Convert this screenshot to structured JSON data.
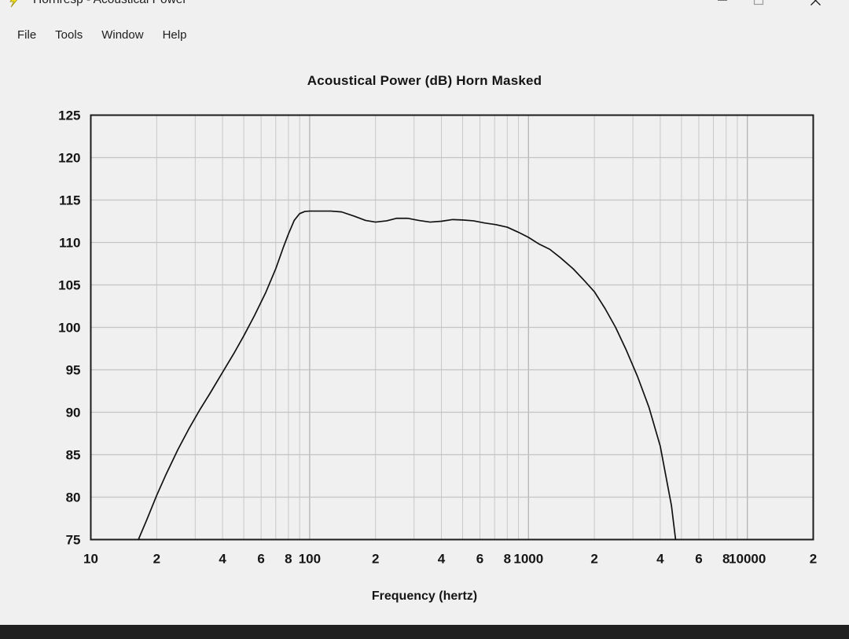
{
  "window": {
    "title": "Hornresp - Acoustical Power",
    "icon": "lightning-bolt-icon",
    "controls": {
      "minimize": "–",
      "maximize": "□",
      "close": "✕"
    }
  },
  "menubar": {
    "items": [
      {
        "label": "File"
      },
      {
        "label": "Tools"
      },
      {
        "label": "Window"
      },
      {
        "label": "Help"
      }
    ]
  },
  "chart_data": {
    "type": "line",
    "title": "Acoustical Power (dB)   Horn   Masked",
    "title_parts": [
      "Acoustical Power (dB)",
      "Horn",
      "Masked"
    ],
    "xlabel": "Frequency (hertz)",
    "ylabel": "",
    "xscale": "log",
    "xlim": [
      10,
      20000
    ],
    "ylim": [
      75,
      125
    ],
    "grid": true,
    "legend": "none",
    "line_color": "#111111",
    "grid_color": "#c8c8c8",
    "axis_color": "#1b1b1b",
    "plot_bg": "#ffffff",
    "ytick_labels": [
      "125",
      "120",
      "115",
      "110",
      "105",
      "100",
      "95",
      "90",
      "85",
      "80",
      "75"
    ],
    "ytick_values": [
      125,
      120,
      115,
      110,
      105,
      100,
      95,
      90,
      85,
      80,
      75
    ],
    "xtick_labels": [
      "10",
      "2",
      "4",
      "6",
      "8",
      "100",
      "2",
      "4",
      "6",
      "8",
      "1000",
      "2",
      "4",
      "6",
      "8",
      "10000",
      "2"
    ],
    "xtick_values": [
      10,
      20,
      40,
      60,
      80,
      100,
      200,
      400,
      600,
      800,
      1000,
      2000,
      4000,
      6000,
      8000,
      10000,
      20000
    ],
    "x": [
      16.5,
      18,
      20,
      22,
      25,
      28,
      31.5,
      35,
      40,
      45,
      50,
      56,
      63,
      70,
      76,
      80,
      85,
      90,
      95,
      100,
      110,
      125,
      140,
      160,
      180,
      200,
      225,
      250,
      280,
      315,
      355,
      400,
      450,
      500,
      560,
      630,
      710,
      800,
      900,
      1000,
      1120,
      1250,
      1400,
      1600,
      1800,
      2000,
      2240,
      2500,
      2800,
      3150,
      3550,
      4000,
      4500,
      4700
    ],
    "y": [
      75.0,
      77.3,
      80.2,
      82.6,
      85.6,
      88.0,
      90.3,
      92.2,
      94.7,
      96.9,
      99.0,
      101.4,
      104.1,
      106.9,
      109.5,
      111.0,
      112.6,
      113.4,
      113.65,
      113.7,
      113.7,
      113.7,
      113.6,
      113.1,
      112.6,
      112.4,
      112.55,
      112.85,
      112.85,
      112.6,
      112.4,
      112.5,
      112.7,
      112.65,
      112.55,
      112.3,
      112.1,
      111.8,
      111.2,
      110.6,
      109.8,
      109.2,
      108.2,
      106.9,
      105.5,
      104.2,
      102.2,
      100.0,
      97.3,
      94.2,
      90.6,
      86.0,
      79.0,
      75.0
    ]
  }
}
